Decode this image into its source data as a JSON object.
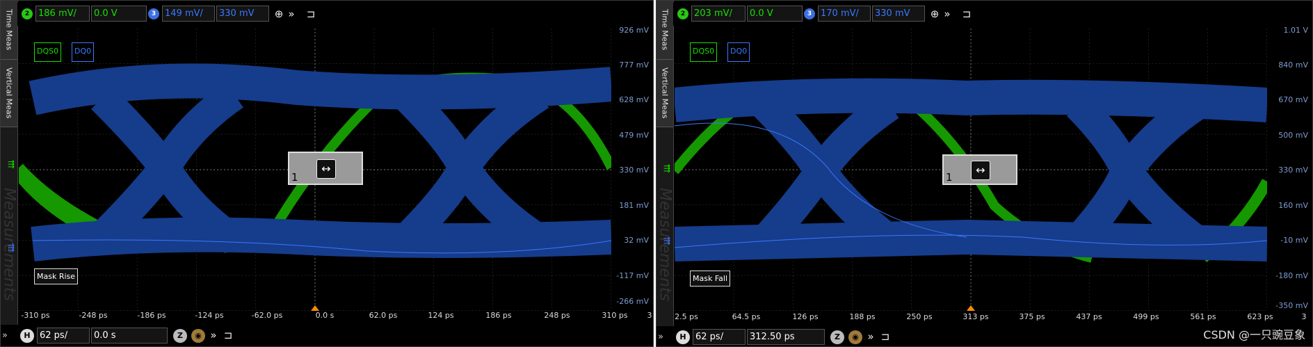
{
  "left": {
    "tabs": {
      "time_meas": "Time Meas",
      "vertical_meas": "Vertical Meas",
      "measurements": "Measurements"
    },
    "ch2": {
      "badge": "2",
      "scale": "186 mV/",
      "offset": "0.0 V"
    },
    "ch3": {
      "badge": "3",
      "scale": "149 mV/",
      "offset": "330 mV"
    },
    "trace_labels": {
      "dqs": "DQS0",
      "dq": "DQ0"
    },
    "mask_label": "Mask Rise",
    "marker_number": "1",
    "y_labels": [
      "926 mV",
      "777 mV",
      "628 mV",
      "479 mV",
      "330 mV",
      "181 mV",
      "32 mV",
      "-117 mV",
      "-266 mV"
    ],
    "x_labels": [
      "-310 ps",
      "-248 ps",
      "-186 ps",
      "-124 ps",
      "-62.0 ps",
      "0.0 s",
      "62.0 ps",
      "124 ps",
      "186 ps",
      "248 ps",
      "310 ps"
    ],
    "x_extra": "3",
    "timebase": {
      "badge": "H",
      "scale": "62 ps/",
      "position": "0.0 s"
    }
  },
  "right": {
    "tabs": {
      "time_meas": "Time Meas",
      "vertical_meas": "Vertical Meas",
      "measurements": "Measurements"
    },
    "ch2": {
      "badge": "2",
      "scale": "203 mV/",
      "offset": "0.0 V"
    },
    "ch3": {
      "badge": "3",
      "scale": "170 mV/",
      "offset": "330 mV"
    },
    "trace_labels": {
      "dqs": "DQS0",
      "dq": "DQ0"
    },
    "mask_label": "Mask Fall",
    "marker_number": "1",
    "y_labels": [
      "1.01 V",
      "840 mV",
      "670 mV",
      "500 mV",
      "330 mV",
      "160 mV",
      "-10 mV",
      "-180 mV",
      "-350 mV"
    ],
    "x_labels": [
      "2.5 ps",
      "64.5 ps",
      "126 ps",
      "188 ps",
      "250 ps",
      "313 ps",
      "375 ps",
      "437 ps",
      "499 ps",
      "561 ps",
      "623 ps"
    ],
    "x_extra": "3",
    "timebase": {
      "badge": "H",
      "scale": "62 ps/",
      "position": "312.50 ps"
    }
  },
  "watermark": "CSDN @一只豌豆象",
  "colors": {
    "dqs": "#18a800",
    "dq": "#163c8c",
    "grid": "#3c3c3c",
    "ch3_text": "#3b78ff",
    "ch2_text": "#19e000"
  }
}
